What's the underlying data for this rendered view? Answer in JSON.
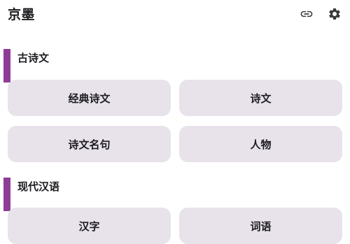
{
  "app_bar": {
    "title": "京墨",
    "actions": [
      {
        "icon": "link-icon"
      },
      {
        "icon": "gear-icon"
      }
    ]
  },
  "colors": {
    "accent": "#8e3d96",
    "tile_background": "#e8e3eb",
    "text": "#1c1b1f"
  },
  "sections": [
    {
      "title": "古诗文",
      "tiles": [
        {
          "label": "经典诗文"
        },
        {
          "label": "诗文"
        },
        {
          "label": "诗文名句"
        },
        {
          "label": "人物"
        }
      ]
    },
    {
      "title": "现代汉语",
      "tiles": [
        {
          "label": "汉字"
        },
        {
          "label": "词语"
        }
      ]
    }
  ]
}
